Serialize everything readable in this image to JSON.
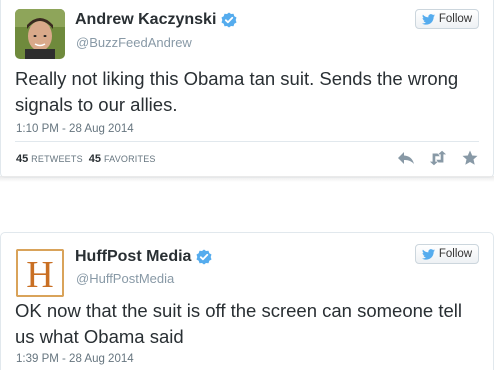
{
  "tweets": [
    {
      "display_name": "Andrew Kaczynski",
      "handle": "@BuzzFeedAndrew",
      "follow_label": "Follow",
      "text": "Really not liking this Obama tan suit. Sends the wrong signals to our allies.",
      "timestamp": "1:10 PM - 28 Aug 2014",
      "retweets_count": "45",
      "retweets_label": "RETWEETS",
      "favorites_count": "45",
      "favorites_label": "FAVORITES"
    },
    {
      "display_name": "HuffPost Media",
      "handle": "@HuffPostMedia",
      "follow_label": "Follow",
      "avatar_letter": "H",
      "text": "OK now that the suit is off the screen can someone tell us what Obama said",
      "timestamp": "1:39 PM - 28 Aug 2014"
    }
  ],
  "icons": {
    "verified": "verified-badge-icon",
    "follow": "twitter-bird-icon",
    "reply": "reply-icon",
    "retweet": "retweet-icon",
    "favorite": "star-icon"
  },
  "colors": {
    "verified": "#55acee",
    "bird": "#55acee",
    "action_icons": "#8899a6",
    "huffpost_h": "#c96f23"
  }
}
